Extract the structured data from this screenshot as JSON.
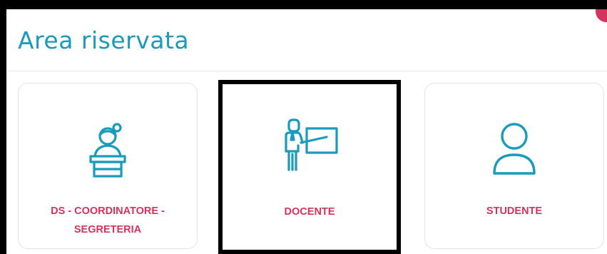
{
  "header": {
    "title": "Area riservata"
  },
  "cards": [
    {
      "label": "DS - COORDINATORE - SEGRETERIA",
      "icon": "receptionist-icon"
    },
    {
      "label": "DOCENTE",
      "icon": "teacher-whiteboard-icon"
    },
    {
      "label": "STUDENTE",
      "icon": "user-icon"
    }
  ],
  "colors": {
    "accent": "#1a9bbd",
    "label": "#d6325e",
    "notification": "#d6325e"
  }
}
